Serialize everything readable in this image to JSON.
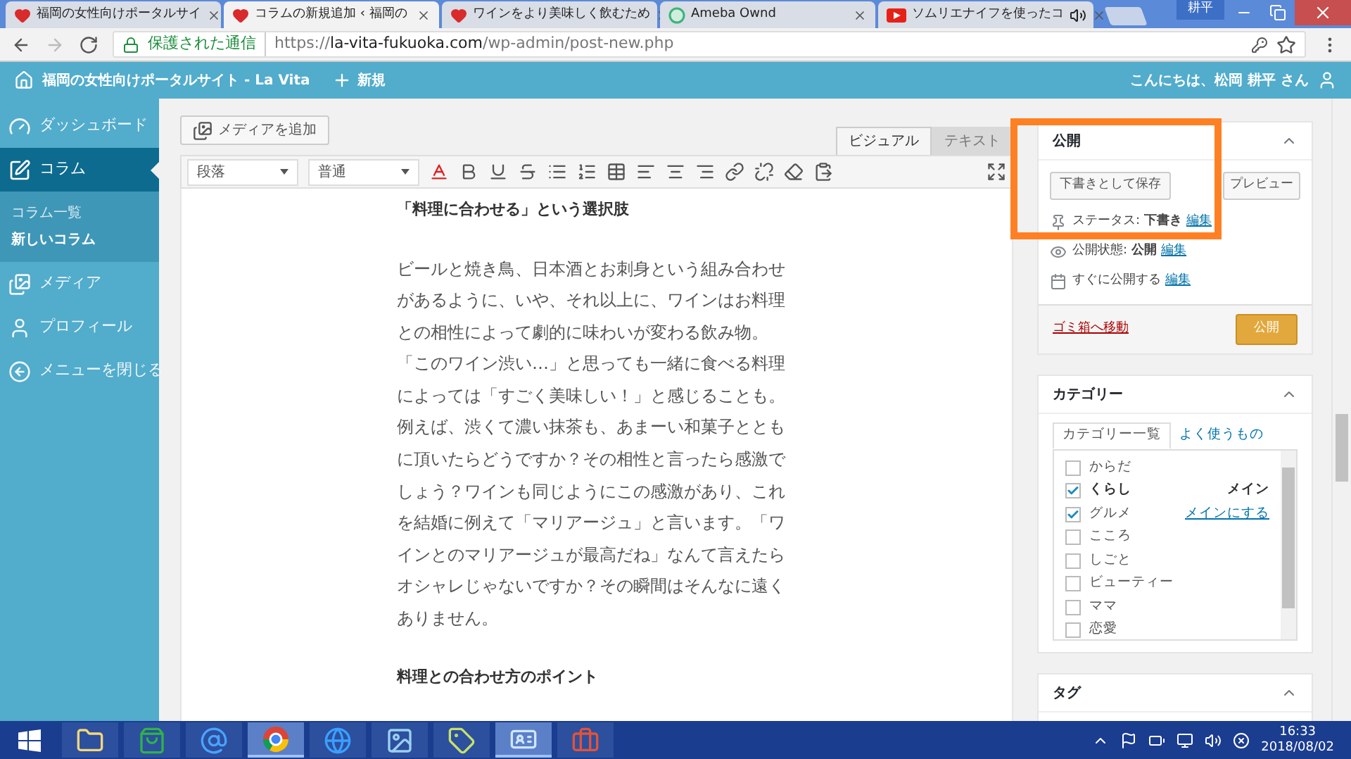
{
  "browser": {
    "tabs": [
      {
        "title": "福岡の女性向けポータルサイ",
        "selected": false,
        "audio": false
      },
      {
        "title": "コラムの新規追加 ‹ 福岡の",
        "selected": true,
        "audio": false
      },
      {
        "title": "ワインをより美味しく飲むため",
        "selected": false,
        "audio": false
      },
      {
        "title": "Ameba Ownd",
        "selected": false,
        "audio": false
      },
      {
        "title": "ソムリエナイフを使ったコ",
        "selected": false,
        "audio": true
      }
    ],
    "window_user": "耕平",
    "security": "保護された通信",
    "url": {
      "scheme": "https://",
      "host": "la-vita-fukuoka.com",
      "path": "/wp-admin/post-new.php"
    }
  },
  "admin_bar": {
    "site": "福岡の女性向けポータルサイト - La Vita",
    "new": "新規",
    "greeting": "こんにちは、松岡 耕平 さん"
  },
  "sidebar": {
    "items": [
      {
        "label": "ダッシュボード",
        "selected": false
      },
      {
        "label": "コラム",
        "selected": true,
        "children": [
          {
            "label": "コラム一覧",
            "selected": false
          },
          {
            "label": "新しいコラム",
            "selected": true
          }
        ]
      },
      {
        "label": "メディア",
        "selected": false
      },
      {
        "label": "プロフィール",
        "selected": false
      },
      {
        "label": "メニューを閉じる",
        "selected": false
      }
    ]
  },
  "editor": {
    "add_media": "メディアを追加",
    "tabs": [
      {
        "label": "ビジュアル",
        "selected": true
      },
      {
        "label": "テキスト",
        "selected": false
      }
    ],
    "format": "段落",
    "font_size": "普通",
    "content": [
      {
        "kind": "heading",
        "text": "「料理に合わせる」という選択肢"
      },
      {
        "kind": "paragraph",
        "text": "ビールと焼き鳥、日本酒とお刺身という組み合わせがあるように、いや、それ以上に、ワインはお料理との相性によって劇的に味わいが変わる飲み物。「このワイン渋い…」と思っても一緒に食べる料理によっては「すごく美味しい！」と感じることも。例えば、渋くて濃い抹茶も、あまーい和菓子とともに頂いたらどうですか？その相性と言ったら感激でしょう？ワインも同じようにこの感激があり、これを結婚に例えて「マリアージュ」と言います。「ワインとのマリアージュが最高だね」なんて言えたらオシャレじゃないですか？その瞬間はそんなに遠くありません。"
      },
      {
        "kind": "heading",
        "text": "料理との合わせ方のポイント"
      }
    ]
  },
  "publish": {
    "title": "公開",
    "save_draft": "下書きとして保存",
    "preview": "プレビュー",
    "rows": [
      {
        "label": "ステータス:",
        "value": "下書き",
        "link": "編集"
      },
      {
        "label": "公開状態:",
        "value": "公開",
        "link": "編集"
      },
      {
        "label": "すぐに公開する",
        "link": "編集"
      }
    ],
    "trash": "ゴミ箱へ移動",
    "publish_button": "公開"
  },
  "categories": {
    "title": "カテゴリー",
    "tabs": [
      {
        "label": "カテゴリー一覧",
        "selected": true
      },
      {
        "label": "よく使うもの",
        "selected": false
      }
    ],
    "items": [
      {
        "name": "からだ",
        "checked": false
      },
      {
        "name": "くらし",
        "checked": true,
        "primary": {
          "kind": "label",
          "text": "メイン"
        }
      },
      {
        "name": "グルメ",
        "checked": true,
        "primary": {
          "kind": "link",
          "text": "メインにする"
        }
      },
      {
        "name": "こころ",
        "checked": false
      },
      {
        "name": "しごと",
        "checked": false
      },
      {
        "name": "ビューティー",
        "checked": false
      },
      {
        "name": "ママ",
        "checked": false
      },
      {
        "name": "恋愛",
        "checked": false
      }
    ]
  },
  "tags": {
    "title": "タグ"
  },
  "taskbar": {
    "apps": [
      {
        "selected": false
      },
      {
        "selected": false
      },
      {
        "selected": false
      },
      {
        "selected": true
      },
      {
        "selected": false
      },
      {
        "selected": false
      },
      {
        "selected": false
      },
      {
        "selected": true
      },
      {
        "selected": false
      }
    ],
    "time": "16:33",
    "date": "2018/08/02"
  }
}
